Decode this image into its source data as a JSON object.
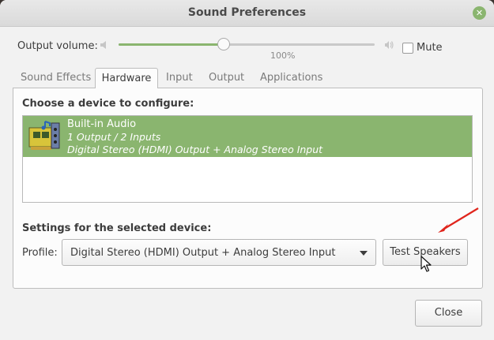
{
  "window": {
    "title": "Sound Preferences",
    "close_glyph": "✕"
  },
  "volume": {
    "label": "Output volume:",
    "percent_label": "100%",
    "level": 0.41,
    "mute_label": "Mute",
    "mute_checked": false
  },
  "tabs": [
    {
      "label": "Sound Effects",
      "active": false
    },
    {
      "label": "Hardware",
      "active": true
    },
    {
      "label": "Input",
      "active": false
    },
    {
      "label": "Output",
      "active": false
    },
    {
      "label": "Applications",
      "active": false
    }
  ],
  "hardware": {
    "choose_title": "Choose a device to configure:",
    "devices": [
      {
        "name": "Built-in Audio",
        "io": "1 Output / 2 Inputs",
        "description": "Digital Stereo (HDMI) Output + Analog Stereo Input",
        "icon": "sound-card-icon",
        "selected": true
      }
    ],
    "settings_title": "Settings for the selected device:",
    "profile_label": "Profile:",
    "profile_value": "Digital Stereo (HDMI) Output + Analog Stereo Input",
    "test_button": "Test Speakers"
  },
  "footer": {
    "close_button": "Close"
  },
  "colors": {
    "accent": "#8ab56f",
    "annotation": "#e0251c"
  }
}
